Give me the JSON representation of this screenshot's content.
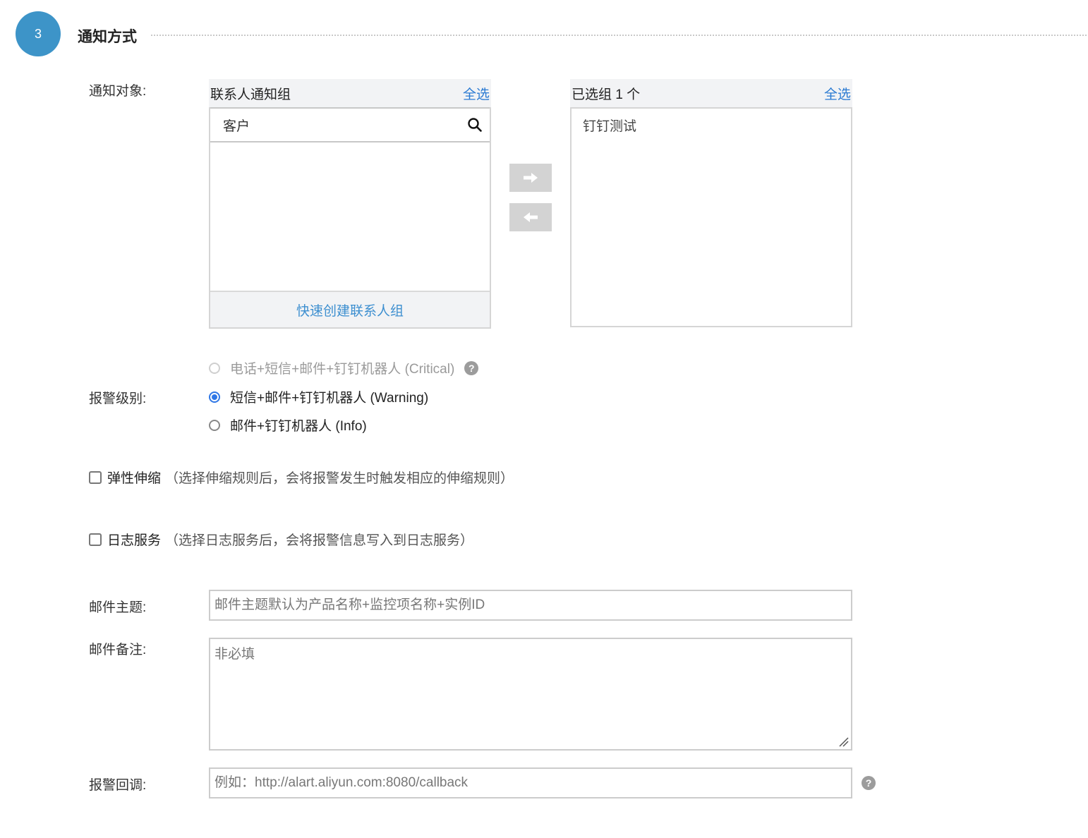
{
  "section": {
    "step_number": "3",
    "title": "通知方式"
  },
  "notify_target": {
    "label": "通知对象:",
    "left_panel": {
      "title": "联系人通知组",
      "select_all": "全选",
      "search_value": "客户",
      "quick_create": "快速创建联系人组"
    },
    "right_panel": {
      "title": "已选组 1 个",
      "select_all": "全选",
      "items": [
        "钉钉测试"
      ]
    },
    "icons": {
      "search": "search-icon",
      "move_right": "arrow-right-icon",
      "move_left": "arrow-left-icon"
    }
  },
  "alarm_level": {
    "label": "报警级别:",
    "options": [
      {
        "text": "电话+短信+邮件+钉钉机器人 (Critical)",
        "state": "disabled"
      },
      {
        "text": "短信+邮件+钉钉机器人 (Warning)",
        "state": "checked"
      },
      {
        "text": "邮件+钉钉机器人 (Info)",
        "state": "unchecked"
      }
    ]
  },
  "elastic_scaling": {
    "label": "弹性伸缩",
    "hint": "（选择伸缩规则后，会将报警发生时触发相应的伸缩规则）",
    "checked": false
  },
  "log_service": {
    "label": "日志服务",
    "hint": "（选择日志服务后，会将报警信息写入到日志服务）",
    "checked": false
  },
  "email_subject": {
    "label": "邮件主题:",
    "placeholder": "邮件主题默认为产品名称+监控项名称+实例ID"
  },
  "email_note": {
    "label": "邮件备注:",
    "placeholder": "非必填"
  },
  "alarm_callback": {
    "label": "报警回调:",
    "placeholder": "例如：http://alart.aliyun.com:8080/callback"
  },
  "colors": {
    "accent": "#3d94c8",
    "link": "#2a7ad2",
    "radio_checked": "#2f77e6"
  }
}
